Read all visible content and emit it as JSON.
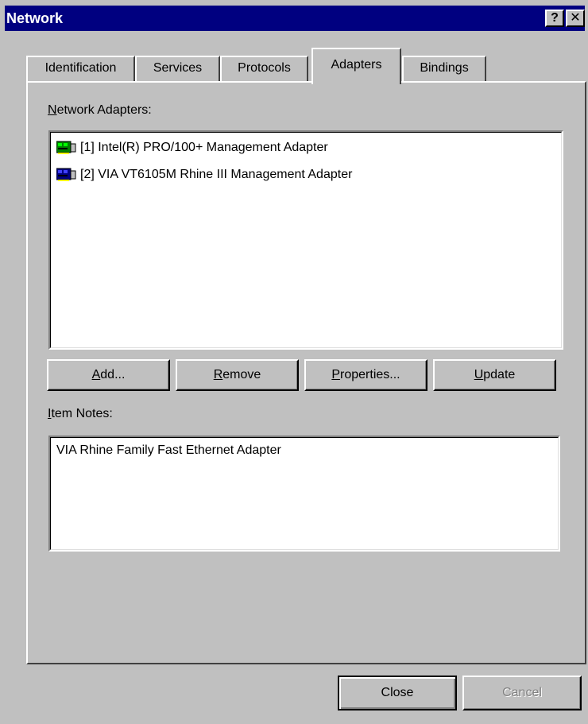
{
  "window": {
    "title": "Network",
    "help_glyph": "?",
    "close_glyph": "✕"
  },
  "tabs": [
    {
      "label": "Identification",
      "active": false
    },
    {
      "label": "Services",
      "active": false
    },
    {
      "label": "Protocols",
      "active": false
    },
    {
      "label": "Adapters",
      "active": true
    },
    {
      "label": "Bindings",
      "active": false
    }
  ],
  "adapters": {
    "heading_mnemonic": "N",
    "heading_rest": "etwork Adapters:",
    "items": [
      {
        "label": "[1] Intel(R) PRO/100+ Management Adapter",
        "icon": "network-card-green-icon",
        "icon_color": "#008000"
      },
      {
        "label": "[2] VIA VT6105M Rhine III Management Adapter",
        "icon": "network-card-blue-icon",
        "icon_color": "#000080"
      }
    ]
  },
  "buttons": {
    "add_m": "A",
    "add_r": "dd...",
    "remove_m": "R",
    "remove_r": "emove",
    "properties_m": "P",
    "properties_r": "roperties...",
    "update_m": "U",
    "update_r": "pdate"
  },
  "notes": {
    "heading_mnemonic": "I",
    "heading_rest": "tem Notes:",
    "text": "VIA Rhine Family Fast Ethernet Adapter"
  },
  "footer": {
    "close_label": "Close",
    "cancel_label": "Cancel"
  }
}
